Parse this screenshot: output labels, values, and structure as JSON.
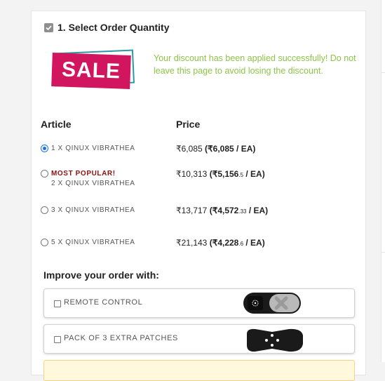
{
  "step": {
    "title": "1. Select Order Quantity"
  },
  "sale_badge": {
    "text": "SALE"
  },
  "discount_message": "Your discount has been applied successfully! Do not leave this page to avoid losing the discount.",
  "table": {
    "headers": {
      "article": "Article",
      "price": "Price"
    },
    "options": [
      {
        "popular": "",
        "article": "1 X QINUX VIBRATHEA",
        "total": "₹6,085",
        "per_unit_main": "₹6,085",
        "per_unit_cents": "",
        "per_unit_suffix": "/ EA)",
        "selected": true
      },
      {
        "popular": "MOST POPULAR!",
        "article": "2 X QINUX VIBRATHEA",
        "total": "₹10,313",
        "per_unit_main": "₹5,156",
        "per_unit_cents": ".5",
        "per_unit_suffix": "/ EA)",
        "selected": false
      },
      {
        "popular": "",
        "article": "3 X QINUX VIBRATHEA",
        "total": "₹13,717",
        "per_unit_main": "₹4,572",
        "per_unit_cents": ".33",
        "per_unit_suffix": "/ EA)",
        "selected": false
      },
      {
        "popular": "",
        "article": "5 X QINUX VIBRATHEA",
        "total": "₹21,143",
        "per_unit_main": "₹4,228",
        "per_unit_cents": ".6",
        "per_unit_suffix": "/ EA)",
        "selected": false
      }
    ]
  },
  "improve": {
    "title": "Improve your order with:",
    "addons": [
      {
        "label": "REMOTE CONTROL",
        "icon": "remote-control-image",
        "checked": false
      },
      {
        "label": "PACK OF 3 EXTRA PATCHES",
        "icon": "patch-pack-image",
        "checked": false
      }
    ]
  },
  "colors": {
    "discount_text": "#8dc44a",
    "sale_pink": "#d2155f",
    "sale_teal": "#2b9aa6",
    "popular_text": "#8b1111",
    "radio_selected": "#1a73e8"
  }
}
